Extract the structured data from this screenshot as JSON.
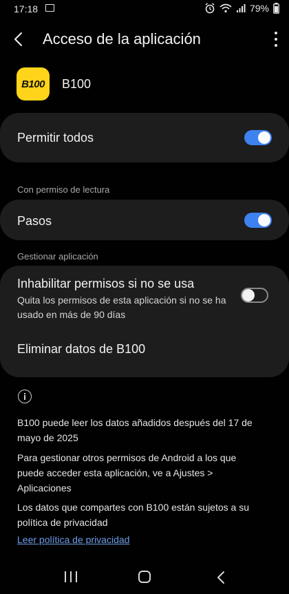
{
  "status_bar": {
    "time": "17:18",
    "battery": "79%",
    "icons": [
      "image-icon",
      "alarm-icon",
      "wifi-icon",
      "signal-icon",
      "battery-icon"
    ]
  },
  "header": {
    "title": "Acceso de la aplicación",
    "back_icon": "back-arrow-icon",
    "menu_icon": "more-vert-icon"
  },
  "app": {
    "logo_text": "B100",
    "name": "B100",
    "logo_color": "#ffd41a"
  },
  "allow_all": {
    "label": "Permitir todos",
    "enabled": true
  },
  "read_section": {
    "title": "Con permiso de lectura",
    "items": [
      {
        "label": "Pasos",
        "enabled": true
      }
    ]
  },
  "manage_section": {
    "title": "Gestionar aplicación",
    "disable_permissions": {
      "label": "Inhabilitar permisos si no se usa",
      "description": "Quita los permisos de esta aplicación si no se ha usado en más de 90 días",
      "enabled": false
    },
    "delete_data_label": "Eliminar datos de B100"
  },
  "info": {
    "icon": "info-icon",
    "para1": "B100 puede leer los datos añadidos después del 17 de mayo de 2025",
    "para2": "Para gestionar otros permisos de Android a los que puede acceder esta aplicación, ve a Ajustes > Aplicaciones",
    "para3": "Los datos que compartes con B100 están sujetos a su política de privacidad",
    "link": "Leer política de privacidad"
  },
  "colors": {
    "accent": "#3e82f0",
    "background": "#010101",
    "card": "#1d1d1d",
    "link": "#6e9dea"
  }
}
